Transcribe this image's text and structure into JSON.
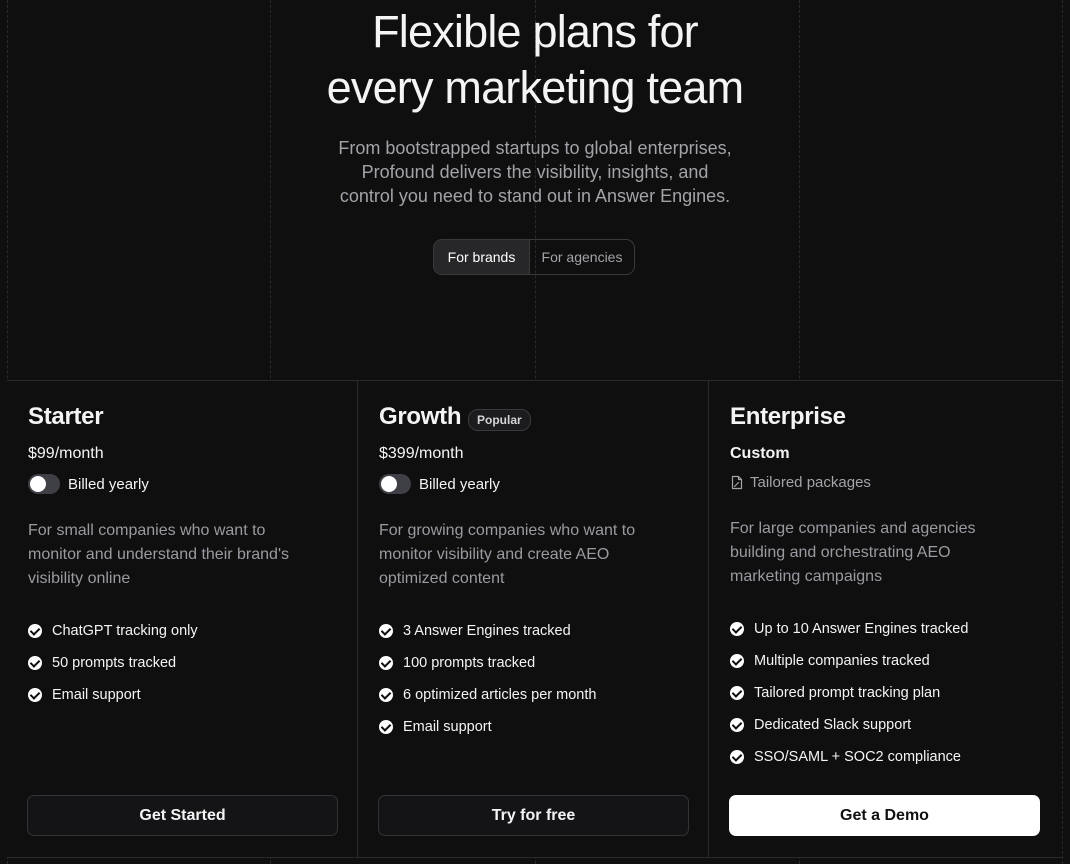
{
  "hero": {
    "title_line1": "Flexible plans for",
    "title_line2": "every marketing team",
    "subtitle_line1": "From bootstrapped startups to global enterprises,",
    "subtitle_line2": "Profound delivers the visibility, insights, and",
    "subtitle_line3": "control you need to stand out in Answer Engines."
  },
  "audience_toggle": {
    "options": [
      "For brands",
      "For agencies"
    ],
    "selected": "For brands"
  },
  "plans": [
    {
      "name": "Starter",
      "price": "$99",
      "period": "/month",
      "billing_label": "Billed yearly",
      "billed_yearly": false,
      "description": [
        "For small companies who want to",
        "monitor and understand their brand's",
        "visibility online"
      ],
      "features": [
        "ChatGPT tracking only",
        "50 prompts tracked",
        "Email support"
      ],
      "cta": "Get Started"
    },
    {
      "name": "Growth",
      "badge": "Popular",
      "price": "$399",
      "period": "/month",
      "billing_label": "Billed yearly",
      "billed_yearly": false,
      "description": [
        "For growing companies who want to",
        "monitor visibility and create AEO",
        "optimized content"
      ],
      "features": [
        "3 Answer Engines tracked",
        "100 prompts tracked",
        "6 optimized articles per month",
        "Email support"
      ],
      "cta": "Try for free"
    },
    {
      "name": "Enterprise",
      "price": "Custom",
      "tailored_label": "Tailored packages",
      "tailored_icon": "document-pen-icon",
      "description": [
        "For large companies and agencies",
        "building and orchestrating AEO",
        "marketing campaigns"
      ],
      "features": [
        "Up to 10 Answer Engines tracked",
        "Multiple companies tracked",
        "Tailored prompt tracking plan",
        "Dedicated Slack support",
        "SSO/SAML + SOC2 compliance"
      ],
      "cta": "Get a Demo"
    }
  ],
  "colors": {
    "background": "#0f0f10",
    "border": "#2a2a2c",
    "muted_text": "#a3a3a8",
    "primary_button": "#ffffff"
  }
}
